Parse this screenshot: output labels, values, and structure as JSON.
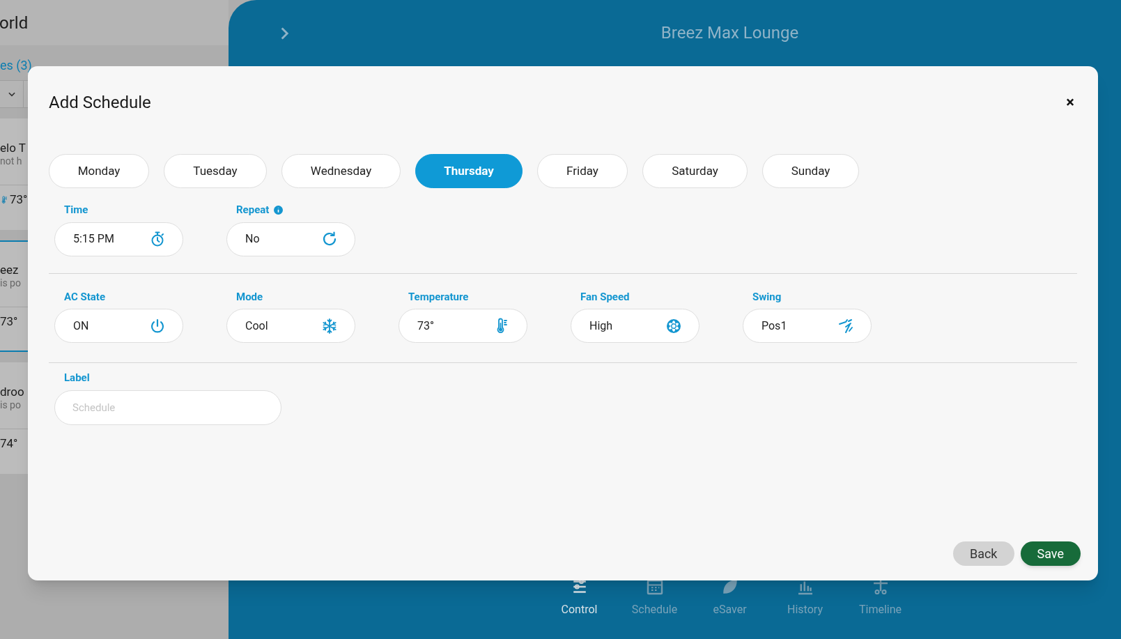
{
  "background": {
    "app_title": "orld",
    "tabs": [
      {
        "label": "es (3)",
        "selected": true
      }
    ],
    "devices": [
      {
        "name": "elo T",
        "status": "not h",
        "temperature": "73°",
        "kind": "with_icon",
        "selected": false
      },
      {
        "name": "eez",
        "status": "is po",
        "temperature": "73°",
        "kind": "plain",
        "selected": true
      },
      {
        "name": "droo",
        "status": "is po",
        "temperature": "74°",
        "kind": "plain",
        "selected": false
      }
    ],
    "panel": {
      "title": "Breez Max Lounge",
      "nav": [
        {
          "label": "Control",
          "kind": "control",
          "selected": true
        },
        {
          "label": "Schedule",
          "kind": "schedule",
          "selected": false
        },
        {
          "label": "eSaver",
          "kind": "esaver",
          "selected": false
        },
        {
          "label": "History",
          "kind": "history",
          "selected": false
        },
        {
          "label": "Timeline",
          "kind": "timeline",
          "selected": false
        }
      ]
    }
  },
  "modal": {
    "title": "Add Schedule",
    "close": "×",
    "days": [
      {
        "label": "Monday",
        "selected": false
      },
      {
        "label": "Tuesday",
        "selected": false
      },
      {
        "label": "Wednesday",
        "selected": false
      },
      {
        "label": "Thursday",
        "selected": true
      },
      {
        "label": "Friday",
        "selected": false
      },
      {
        "label": "Saturday",
        "selected": false
      },
      {
        "label": "Sunday",
        "selected": false
      }
    ],
    "schedule_fields": [
      {
        "label": "Time",
        "value": "5:15 PM",
        "kind": "time"
      },
      {
        "label": "Repeat",
        "value": "No",
        "kind": "repeat",
        "info": true
      }
    ],
    "ac_fields": [
      {
        "label": "AC State",
        "value": "ON",
        "kind": "power"
      },
      {
        "label": "Mode",
        "value": "Cool",
        "kind": "mode"
      },
      {
        "label": "Temperature",
        "value": "73°",
        "kind": "temperature"
      },
      {
        "label": "Fan Speed",
        "value": "High",
        "kind": "fan"
      },
      {
        "label": "Swing",
        "value": "Pos1",
        "kind": "swing"
      }
    ],
    "label_field": {
      "label": "Label",
      "placeholder": "Schedule"
    },
    "buttons": [
      {
        "label": "Back",
        "kind": "secondary"
      },
      {
        "label": "Save",
        "kind": "primary"
      }
    ]
  }
}
